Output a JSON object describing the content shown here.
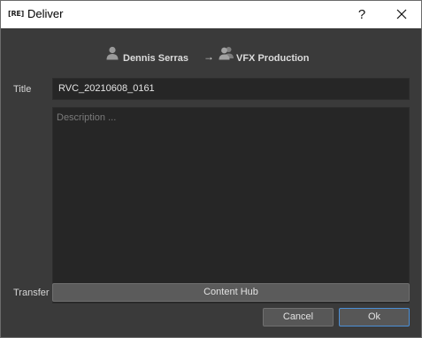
{
  "window": {
    "app_logo": "[RE]",
    "title": "Deliver",
    "help_label": "?"
  },
  "route": {
    "from_name": "Dennis Serras",
    "arrow": "→",
    "to_name": "VFX Production"
  },
  "form": {
    "title_label": "Title",
    "title_value": "RVC_20210608_0161",
    "description_placeholder": "Description ...",
    "transfer_label": "Transfer",
    "transfer_value": "Content Hub"
  },
  "buttons": {
    "cancel": "Cancel",
    "ok": "Ok"
  },
  "colors": {
    "background": "#3a3a3a",
    "field_background": "#262626",
    "button_background": "#575757",
    "ok_focus_border": "#4b8fd6"
  },
  "icons": {
    "sender": "user-icon",
    "recipient": "group-icon",
    "close": "close-icon"
  }
}
